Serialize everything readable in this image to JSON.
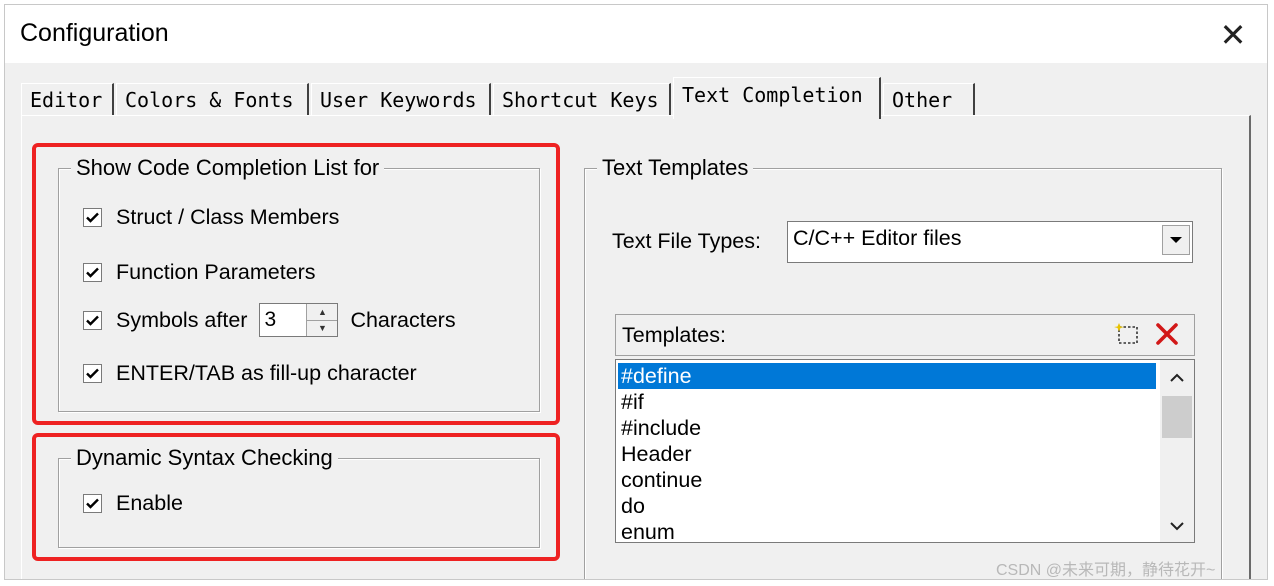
{
  "window": {
    "title": "Configuration",
    "close_glyph": "✕"
  },
  "tabs": [
    {
      "label": "Editor",
      "active": false
    },
    {
      "label": "Colors & Fonts",
      "active": false
    },
    {
      "label": "User Keywords",
      "active": false
    },
    {
      "label": "Shortcut Keys",
      "active": false
    },
    {
      "label": "Text Completion",
      "active": true
    },
    {
      "label": "Other",
      "active": false
    }
  ],
  "code_completion": {
    "legend": "Show Code Completion List for",
    "struct_members": {
      "label": "Struct / Class Members",
      "checked": true
    },
    "function_params": {
      "label": "Function Parameters",
      "checked": true
    },
    "symbols_after": {
      "label": "Symbols after",
      "value": "3",
      "suffix": "Characters",
      "checked": true
    },
    "enter_tab": {
      "label": "ENTER/TAB as fill-up character",
      "checked": true
    }
  },
  "syntax_checking": {
    "legend": "Dynamic Syntax Checking",
    "enable": {
      "label": "Enable",
      "checked": true
    }
  },
  "text_templates": {
    "legend": "Text Templates",
    "file_types_label": "Text File Types:",
    "file_types_value": "C/C++ Editor files",
    "templates_label": "Templates:",
    "templates": [
      "#define",
      "#if",
      "#include",
      "Header",
      "continue",
      "do",
      "enum"
    ],
    "selected_index": 0
  },
  "icons": {
    "close": "close-icon",
    "checkmark": "checkmark-icon",
    "new_template": "new-template-icon",
    "delete_template": "delete-icon"
  },
  "colors": {
    "highlight": "#ee2222",
    "selection": "#0078d7"
  },
  "watermark": "CSDN @未来可期，静待花开~"
}
